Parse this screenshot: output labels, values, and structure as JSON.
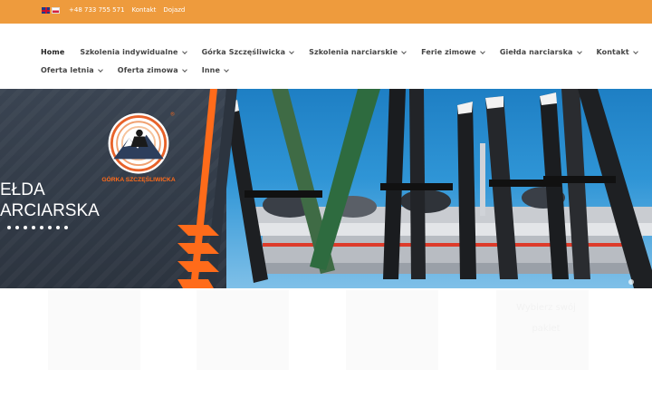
{
  "topbar": {
    "phone": "+48 733 755 571",
    "contact": "Kontakt",
    "directions": "Dojazd",
    "languages": [
      "English",
      "Polski"
    ]
  },
  "nav": {
    "items": [
      {
        "label": "Home",
        "dropdown": false,
        "active": true
      },
      {
        "label": "Szkolenia indywidualne",
        "dropdown": true
      },
      {
        "label": "Górka Szczęśliwicka",
        "dropdown": true
      },
      {
        "label": "Szkolenia narciarskie",
        "dropdown": true
      },
      {
        "label": "Ferie zimowe",
        "dropdown": true
      },
      {
        "label": "Giełda narciarska",
        "dropdown": true
      },
      {
        "label": "Kontakt",
        "dropdown": true
      },
      {
        "label": "Oferta letnia",
        "dropdown": true
      },
      {
        "label": "Oferta zimowa",
        "dropdown": true
      },
      {
        "label": "Inne",
        "dropdown": true
      }
    ]
  },
  "hero": {
    "title_line1": "EŁDA",
    "title_line2": "ARCIARSKA",
    "logo_text": "GÓRKA SZCZĘŚLIWICKA",
    "slider_dots": 8
  },
  "content": {
    "faded_text_line1": "Wybierz swój",
    "faded_text_line2": "pakiet"
  },
  "colors": {
    "topbar": "#ee9b3d",
    "accent_orange": "#ff6b1a",
    "hero_dark": "#3a4452",
    "sky": "#2f95d6"
  }
}
